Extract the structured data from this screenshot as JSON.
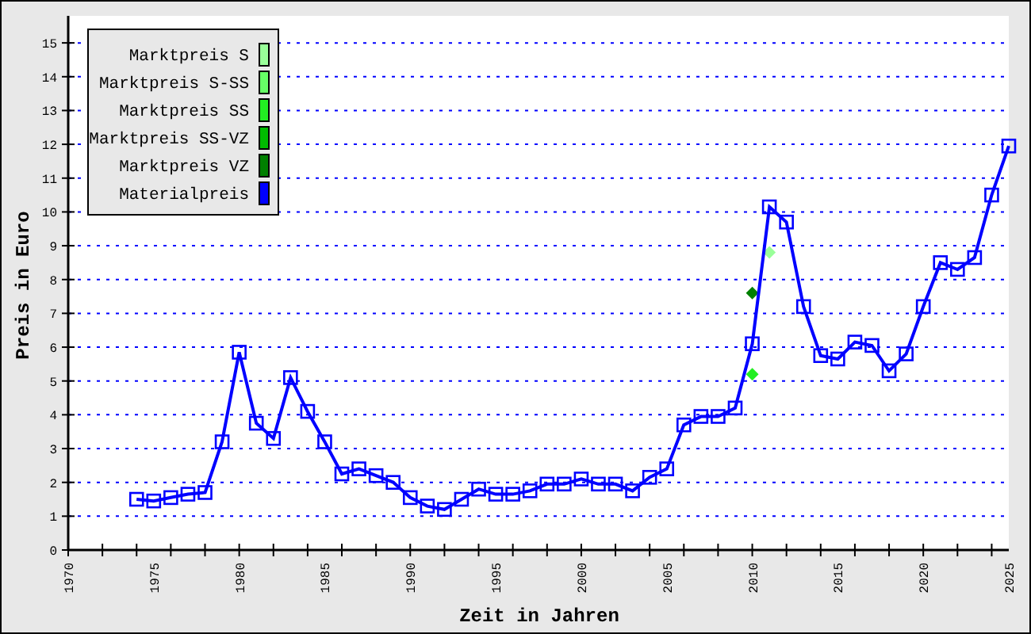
{
  "chart_data": {
    "type": "line",
    "xlabel": "Zeit in Jahren",
    "ylabel": "Preis in Euro",
    "x": [
      1974,
      1975,
      1976,
      1977,
      1978,
      1979,
      1980,
      1981,
      1982,
      1983,
      1984,
      1985,
      1986,
      1987,
      1988,
      1989,
      1990,
      1991,
      1992,
      1993,
      1994,
      1995,
      1996,
      1997,
      1998,
      1999,
      2000,
      2001,
      2002,
      2003,
      2004,
      2005,
      2006,
      2007,
      2008,
      2009,
      2010,
      2011,
      2012,
      2013,
      2014,
      2015,
      2016,
      2017,
      2018,
      2019,
      2020,
      2021,
      2022,
      2023,
      2024,
      2025
    ],
    "series": [
      {
        "name": "Marktpreis S",
        "color": "#99ff99",
        "marker": "diamond",
        "values": [
          null,
          null,
          null,
          null,
          null,
          null,
          null,
          null,
          null,
          null,
          null,
          null,
          null,
          null,
          null,
          null,
          null,
          null,
          null,
          null,
          null,
          null,
          null,
          null,
          null,
          null,
          null,
          null,
          null,
          null,
          null,
          null,
          null,
          null,
          null,
          null,
          null,
          8.8,
          null,
          null,
          null,
          null,
          null,
          null,
          null,
          null,
          null,
          null,
          null,
          null,
          null,
          null
        ]
      },
      {
        "name": "Marktpreis S-SS",
        "color": "#66ff66",
        "values": [
          null,
          null,
          null,
          null,
          null,
          null,
          null,
          null,
          null,
          null,
          null,
          null,
          null,
          null,
          null,
          null,
          null,
          null,
          null,
          null,
          null,
          null,
          null,
          null,
          null,
          null,
          null,
          null,
          null,
          null,
          null,
          null,
          null,
          null,
          null,
          null,
          null,
          null,
          null,
          null,
          null,
          null,
          null,
          null,
          null,
          null,
          null,
          null,
          null,
          null,
          null,
          null
        ]
      },
      {
        "name": "Marktpreis SS",
        "color": "#22ee22",
        "marker": "diamond",
        "values": [
          null,
          null,
          null,
          null,
          null,
          null,
          null,
          null,
          null,
          null,
          null,
          null,
          null,
          null,
          null,
          null,
          null,
          null,
          null,
          null,
          null,
          null,
          null,
          null,
          null,
          null,
          null,
          null,
          null,
          null,
          null,
          null,
          null,
          null,
          null,
          null,
          5.2,
          null,
          null,
          null,
          null,
          null,
          null,
          null,
          null,
          null,
          null,
          null,
          null,
          null,
          null,
          null
        ]
      },
      {
        "name": "Marktpreis SS-VZ",
        "color": "#00bb00",
        "values": [
          null,
          null,
          null,
          null,
          null,
          null,
          null,
          null,
          null,
          null,
          null,
          null,
          null,
          null,
          null,
          null,
          null,
          null,
          null,
          null,
          null,
          null,
          null,
          null,
          null,
          null,
          null,
          null,
          null,
          null,
          null,
          null,
          null,
          null,
          null,
          null,
          null,
          null,
          null,
          null,
          null,
          null,
          null,
          null,
          null,
          null,
          null,
          null,
          null,
          null,
          null,
          null
        ]
      },
      {
        "name": "Marktpreis VZ",
        "color": "#008000",
        "marker": "diamond",
        "values": [
          null,
          null,
          null,
          null,
          null,
          null,
          null,
          null,
          null,
          null,
          null,
          null,
          null,
          null,
          null,
          null,
          null,
          null,
          null,
          null,
          null,
          null,
          null,
          null,
          null,
          null,
          null,
          null,
          null,
          null,
          null,
          null,
          null,
          null,
          null,
          null,
          7.6,
          null,
          null,
          null,
          null,
          null,
          null,
          null,
          null,
          null,
          null,
          null,
          null,
          null,
          null,
          null
        ]
      },
      {
        "name": "Materialpreis",
        "color": "#0000ff",
        "marker": "square",
        "values": [
          1.5,
          1.45,
          1.55,
          1.65,
          1.7,
          3.2,
          5.85,
          3.75,
          3.3,
          5.1,
          4.1,
          3.2,
          2.25,
          2.4,
          2.2,
          2.0,
          1.55,
          1.3,
          1.2,
          1.5,
          1.8,
          1.65,
          1.65,
          1.75,
          1.95,
          1.95,
          2.1,
          1.95,
          1.95,
          1.75,
          2.15,
          2.4,
          3.7,
          3.95,
          3.95,
          4.2,
          6.1,
          10.15,
          9.7,
          7.2,
          5.75,
          5.65,
          6.15,
          6.05,
          5.3,
          5.8,
          7.2,
          8.5,
          8.3,
          8.65,
          10.5,
          11.95
        ]
      }
    ],
    "xlim": [
      1970,
      2025
    ],
    "ylim": [
      0,
      15.8
    ],
    "xticks": [
      1970,
      1975,
      1980,
      1985,
      1990,
      1995,
      2000,
      2005,
      2010,
      2015,
      2020,
      2025
    ],
    "yticks": [
      0,
      1,
      2,
      3,
      4,
      5,
      6,
      7,
      8,
      9,
      10,
      11,
      12,
      13,
      14,
      15
    ],
    "legend": "upper left"
  }
}
